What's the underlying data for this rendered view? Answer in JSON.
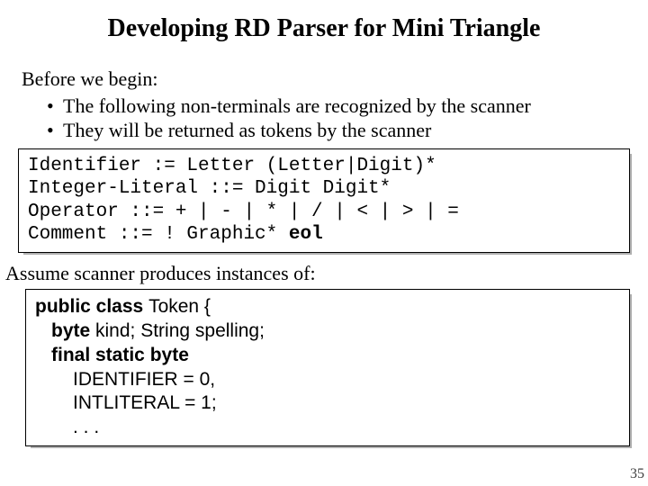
{
  "title": "Developing RD Parser for Mini Triangle",
  "intro": {
    "lead": "Before we begin:",
    "bullets": [
      "The following non-terminals are recognized by the scanner",
      "They will be returned as tokens by the scanner"
    ]
  },
  "grammar": {
    "line1": "Identifier := Letter (Letter|Digit)*",
    "line2": "Integer-Literal ::= Digit Digit*",
    "line3": "Operator ::= + | - | * | / | < | > | =",
    "line4_prefix": "Comment ::= ! Graphic* ",
    "line4_eol": "eol"
  },
  "assume": "Assume scanner produces instances of:",
  "token": {
    "l1a": "public class ",
    "l1b": "Token {",
    "l2a": "byte ",
    "l2b": "kind; String spelling;",
    "l3a": "final static byte",
    "l4": "IDENTIFIER = 0,",
    "l5": "INTLITERAL = 1;",
    "l6": ". . ."
  },
  "pagenum": "35"
}
